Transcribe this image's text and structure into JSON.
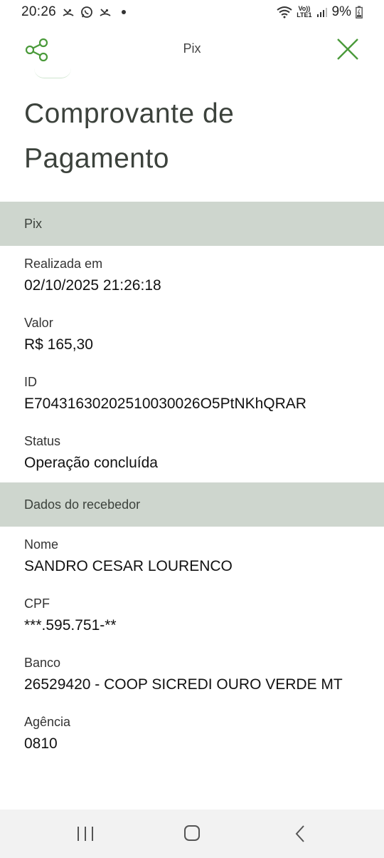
{
  "status_bar": {
    "time": "20:26",
    "left_icons": [
      "missed-call-icon",
      "whatsapp-icon",
      "missed-call-icon",
      "notification-dot-icon"
    ],
    "volte_label": "Vo))",
    "lte_label": "LTE1",
    "battery": "9%"
  },
  "header": {
    "title": "Pix",
    "share_icon": "share-icon",
    "close_icon": "close-icon"
  },
  "page_title": "Comprovante de Pagamento",
  "sections": {
    "pix": {
      "heading": "Pix",
      "fields": [
        {
          "label": "Realizada em",
          "value": "02/10/2025 21:26:18"
        },
        {
          "label": "Valor",
          "value": "R$ 165,30"
        },
        {
          "label": "ID",
          "value": "E70431630202510030026O5PtNKhQRAR"
        },
        {
          "label": "Status",
          "value": "Operação concluída"
        }
      ]
    },
    "recebedor": {
      "heading": "Dados do recebedor",
      "fields": [
        {
          "label": "Nome",
          "value": "SANDRO CESAR LOURENCO"
        },
        {
          "label": "CPF",
          "value": "***.595.751-**"
        },
        {
          "label": "Banco",
          "value": "26529420 - COOP SICREDI OURO VERDE MT"
        },
        {
          "label": "Agência",
          "value": "0810"
        }
      ]
    }
  },
  "nav": {
    "icons": [
      "recent-apps-icon",
      "home-icon",
      "back-icon"
    ]
  },
  "colors": {
    "accent": "#4a9a3a",
    "section_band": "#ced6ce",
    "title_text": "#3c423c"
  }
}
